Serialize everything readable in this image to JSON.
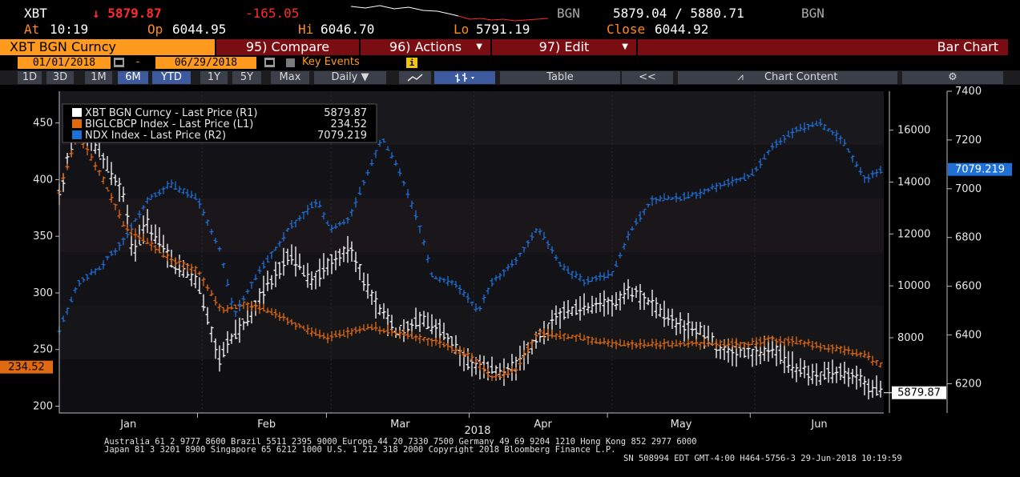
{
  "quote": {
    "ticker": "XBT",
    "last": "↓ 5879.87",
    "change": "-165.05",
    "source_left": "BGN",
    "bid_ask": "5879.04 / 5880.71",
    "source_right": "BGN",
    "at_label": "At",
    "time": "10:19",
    "op_label": "Op",
    "open": "6044.95",
    "hi_label": "Hi",
    "high": "6046.70",
    "lo_label": "Lo",
    "low": "5791.19",
    "close_label": "Close",
    "close": "6044.92"
  },
  "menubar": {
    "security": "XBT BGN Curncy",
    "compare": "95) Compare",
    "actions": "96) Actions",
    "edit": "97) Edit",
    "chart_type": "Bar Chart"
  },
  "daterow": {
    "start": "01/01/2018",
    "dash": "-",
    "end": "06/29/2018",
    "key_events": "Key Events",
    "info": "i"
  },
  "toolbar": {
    "ranges": [
      "1D",
      "3D",
      "1M",
      "6M",
      "YTD",
      "1Y",
      "5Y",
      "Max"
    ],
    "active_ranges": [
      "6M",
      "YTD"
    ],
    "frequency": "Daily ▼",
    "table": "Table",
    "back": "<<",
    "chart_content": "Chart Content",
    "icons": [
      "line-chart-icon",
      "bar-chart-icon",
      "mountain-icon",
      "gear-icon"
    ]
  },
  "chart_data": {
    "type": "bar",
    "x_labels": [
      "Jan",
      "Feb",
      "Mar",
      "Apr",
      "May",
      "Jun"
    ],
    "x_year": "2018",
    "left_axis": {
      "ticks": [
        200,
        250,
        300,
        350,
        400,
        450
      ],
      "range": [
        194,
        478
      ]
    },
    "r1_axis": {
      "ticks": [
        8000,
        10000,
        12000,
        14000,
        16000
      ],
      "range": [
        5100,
        17500
      ]
    },
    "r2_axis": {
      "ticks": [
        6200,
        6400,
        6600,
        6800,
        7000,
        7200,
        7400
      ],
      "range": [
        6080,
        7400
      ]
    },
    "legend": [
      {
        "label": "XBT BGN Curncy - Last Price (R1)",
        "value": "5879.87",
        "color": "#ffffff"
      },
      {
        "label": "BIGLCBCP Index - Last Price (L1)",
        "value": "234.52",
        "color": "#e06a12"
      },
      {
        "label": "NDX Index - Last Price (R2)",
        "value": "7079.219",
        "color": "#1e6fd6"
      }
    ],
    "tags": {
      "left": "234.52",
      "r1": "5879.87",
      "r2": "7079.219"
    },
    "series": [
      {
        "name": "XBT BGN Curncy",
        "axis": "r1",
        "color": "#ffffff",
        "x": [
          "01-01",
          "01-05",
          "01-10",
          "01-15",
          "01-17",
          "01-20",
          "01-25",
          "01-31",
          "02-05",
          "02-06",
          "02-10",
          "02-15",
          "02-20",
          "02-25",
          "03-01",
          "03-05",
          "03-10",
          "03-15",
          "03-20",
          "03-25",
          "03-31",
          "04-05",
          "04-06",
          "04-10",
          "04-15",
          "04-20",
          "04-25",
          "05-01",
          "05-05",
          "05-10",
          "05-15",
          "05-20",
          "05-25",
          "05-31",
          "06-05",
          "06-10",
          "06-15",
          "06-20",
          "06-25",
          "06-29"
        ],
        "values": [
          13500,
          16500,
          15000,
          13500,
          11200,
          12500,
          11000,
          10200,
          7000,
          7600,
          8500,
          10000,
          11200,
          10200,
          11000,
          11500,
          9500,
          8200,
          8700,
          8300,
          7000,
          6800,
          6600,
          6900,
          8000,
          8900,
          9200,
          9300,
          9800,
          9300,
          8500,
          8300,
          7500,
          7400,
          7600,
          6800,
          6500,
          6700,
          6200,
          5880
        ]
      },
      {
        "name": "BIGLCBCP Index",
        "axis": "left",
        "color": "#e06a12",
        "x": [
          "01-01",
          "01-05",
          "01-10",
          "01-15",
          "01-20",
          "01-25",
          "01-31",
          "02-05",
          "02-10",
          "02-15",
          "02-20",
          "02-28",
          "03-05",
          "03-10",
          "03-15",
          "03-20",
          "03-25",
          "03-31",
          "04-05",
          "04-10",
          "04-15",
          "04-20",
          "04-25",
          "05-01",
          "05-10",
          "05-20",
          "05-31",
          "06-05",
          "06-10",
          "06-15",
          "06-20",
          "06-25",
          "06-29"
        ],
        "values": [
          390,
          440,
          405,
          360,
          345,
          330,
          320,
          285,
          290,
          285,
          275,
          260,
          265,
          270,
          265,
          260,
          255,
          245,
          225,
          232,
          265,
          262,
          260,
          255,
          255,
          255,
          255,
          259,
          257,
          253,
          250,
          245,
          234.52
        ]
      },
      {
        "name": "NDX Index",
        "axis": "r2",
        "color": "#1e6fd6",
        "x": [
          "01-01",
          "01-05",
          "01-10",
          "01-15",
          "01-20",
          "01-25",
          "01-31",
          "02-05",
          "02-08",
          "02-12",
          "02-20",
          "02-26",
          "03-01",
          "03-05",
          "03-12",
          "03-15",
          "03-20",
          "03-23",
          "03-28",
          "04-02",
          "04-05",
          "04-10",
          "04-15",
          "04-20",
          "04-25",
          "05-01",
          "05-05",
          "05-10",
          "05-15",
          "05-20",
          "05-25",
          "05-31",
          "06-05",
          "06-10",
          "06-15",
          "06-20",
          "06-25",
          "06-29"
        ],
        "values": [
          6420,
          6610,
          6680,
          6790,
          6950,
          7020,
          6960,
          6740,
          6480,
          6620,
          6840,
          6950,
          6830,
          6880,
          7210,
          7110,
          6860,
          6640,
          6610,
          6500,
          6620,
          6700,
          6840,
          6680,
          6620,
          6650,
          6830,
          6960,
          6960,
          6980,
          7020,
          7050,
          7180,
          7240,
          7270,
          7200,
          7040,
          7079.219
        ]
      }
    ]
  },
  "footer": {
    "line1": "Australia 61 2 9777 8600 Brazil 5511 2395 9000 Europe 44 20 7330 7500 Germany 49 69 9204 1210 Hong Kong 852 2977 6000",
    "line2": "Japan 81 3 3201 8900       Singapore 65 6212 1000       U.S. 1 212 318 2000          Copyright 2018 Bloomberg Finance L.P.",
    "line3": "SN 508994 EDT  GMT-4:00 H464-5756-3 29-Jun-2018 10:19:59"
  }
}
